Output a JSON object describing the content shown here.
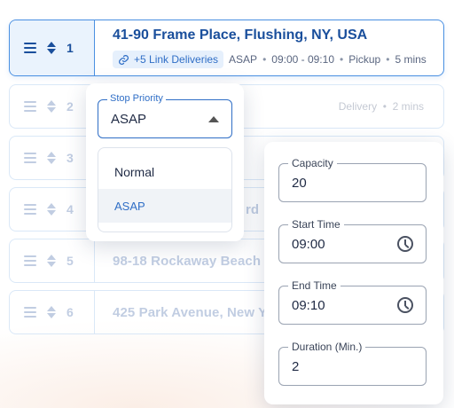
{
  "stops": [
    {
      "number": "1",
      "address": "41-90 Frame Place, Flushing, NY, USA",
      "link_label": "+5 Link Deliveries",
      "priority": "ASAP",
      "time_window": "09:00 - 09:10",
      "type": "Pickup",
      "duration": "5 mins"
    },
    {
      "number": "2",
      "address": "",
      "type": "Delivery",
      "duration": "2 mins"
    },
    {
      "number": "3",
      "address": ""
    },
    {
      "number": "4",
      "address": "rd"
    },
    {
      "number": "5",
      "address": "98-18 Rockaway Beach"
    },
    {
      "number": "6",
      "address": "425 Park Avenue, New Y"
    }
  ],
  "priority_dropdown": {
    "label": "Stop Priority",
    "value": "ASAP",
    "options": [
      "Normal",
      "ASAP"
    ]
  },
  "time_panel": {
    "capacity_label": "Capacity",
    "capacity_value": "20",
    "start_label": "Start Time",
    "start_value": "09:00",
    "end_label": "End Time",
    "end_value": "09:10",
    "duration_label": "Duration (Min.)",
    "duration_value": "2"
  },
  "colors": {
    "accent": "#2f6ec6",
    "title_blue": "#1a4f9c",
    "border": "#bcd6f2"
  }
}
